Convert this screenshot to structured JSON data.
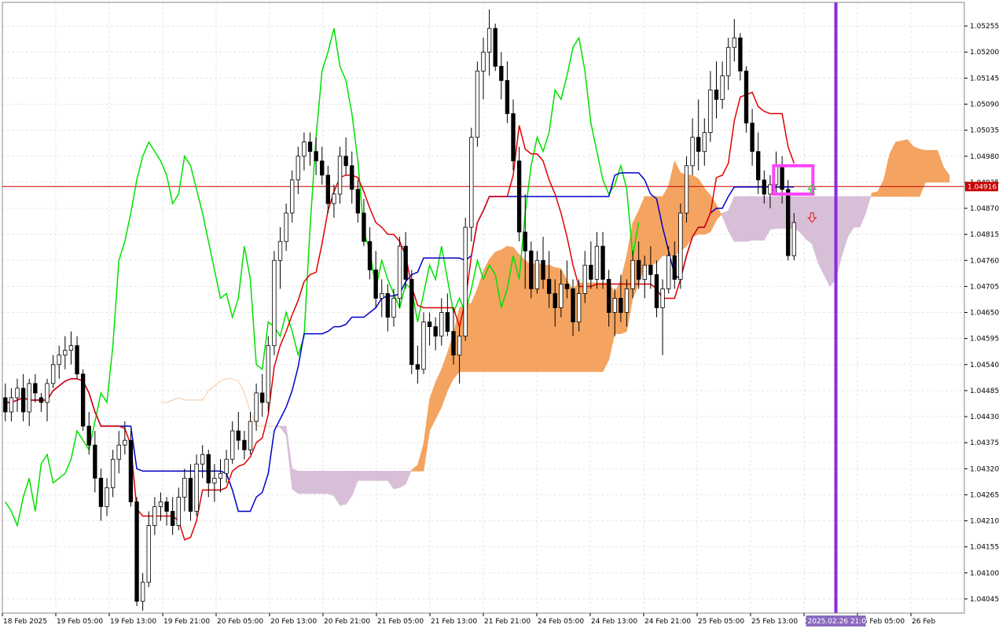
{
  "chart_data": {
    "type": "candlestick",
    "instrument_timeframe": "",
    "y_ticks": [
      "1.05255",
      "1.05200",
      "1.05145",
      "1.05090",
      "1.05035",
      "1.04980",
      "1.04925",
      "1.04870",
      "1.04815",
      "1.04760",
      "1.04705",
      "1.04650",
      "1.04595",
      "1.04540",
      "1.04485",
      "1.04430",
      "1.04375",
      "1.04320",
      "1.04265",
      "1.04210",
      "1.04155",
      "1.04100",
      "1.04045"
    ],
    "ylim": [
      1.04015,
      1.05305
    ],
    "x_labels": [
      "18 Feb 2025",
      "19 Feb 05:00",
      "19 Feb 13:00",
      "19 Feb 21:00",
      "20 Feb 05:00",
      "20 Feb 13:00",
      "20 Feb 21:00",
      "21 Feb 05:00",
      "21 Feb 13:00",
      "21 Feb 21:00",
      "24 Feb 05:00",
      "24 Feb 13:00",
      "24 Feb 21:00",
      "25 Feb 05:00",
      "25 Feb 13:00",
      "25 Feb 21:00",
      "26 Feb 05:00",
      "26 Feb"
    ],
    "current_price": "1.04916",
    "vline_label": "2025.02.26 21:00",
    "grid": true,
    "colors": {
      "bull_body": "#ffffff",
      "bear_body": "#000000",
      "tenkan": "#e00000",
      "kijun": "#0000c8",
      "chikou": "#00e000",
      "kumo_bull": "#f4a460",
      "kumo_bear": "#d8bfd8",
      "price_line": "#c80000",
      "vline": "#8a2be2",
      "highlight": "#ff44ff"
    },
    "candles": [
      [
        1.0447,
        1.045,
        1.0442,
        1.0444
      ],
      [
        1.0444,
        1.0449,
        1.0442,
        1.0447
      ],
      [
        1.0447,
        1.0451,
        1.0444,
        1.0449
      ],
      [
        1.0449,
        1.0452,
        1.0442,
        1.0444
      ],
      [
        1.0444,
        1.0451,
        1.0441,
        1.045
      ],
      [
        1.045,
        1.0452,
        1.0446,
        1.0448
      ],
      [
        1.0447,
        1.0448,
        1.0444,
        1.0446
      ],
      [
        1.0446,
        1.0451,
        1.0442,
        1.045
      ],
      [
        1.045,
        1.0456,
        1.0449,
        1.0454
      ],
      [
        1.0454,
        1.0458,
        1.0451,
        1.0456
      ],
      [
        1.0456,
        1.046,
        1.0453,
        1.0457
      ],
      [
        1.0457,
        1.0461,
        1.0454,
        1.0458
      ],
      [
        1.0458,
        1.046,
        1.0451,
        1.0452
      ],
      [
        1.0452,
        1.0453,
        1.044,
        1.0441
      ],
      [
        1.0441,
        1.0444,
        1.0435,
        1.0437
      ],
      [
        1.0437,
        1.044,
        1.0427,
        1.043
      ],
      [
        1.043,
        1.0432,
        1.0421,
        1.0424
      ],
      [
        1.0424,
        1.043,
        1.0422,
        1.0428
      ],
      [
        1.0428,
        1.0436,
        1.0426,
        1.0434
      ],
      [
        1.0434,
        1.044,
        1.0431,
        1.0437
      ],
      [
        1.0437,
        1.0442,
        1.0435,
        1.0438
      ],
      [
        1.0438,
        1.044,
        1.0424,
        1.0425
      ],
      [
        1.0425,
        1.0426,
        1.0403,
        1.0404
      ],
      [
        1.0404,
        1.041,
        1.0402,
        1.0408
      ],
      [
        1.0408,
        1.0423,
        1.0407,
        1.042
      ],
      [
        1.042,
        1.0426,
        1.0418,
        1.0424
      ],
      [
        1.0424,
        1.0427,
        1.0421,
        1.0425
      ],
      [
        1.0425,
        1.0426,
        1.042,
        1.0423
      ],
      [
        1.0423,
        1.0426,
        1.0418,
        1.042
      ],
      [
        1.042,
        1.0428,
        1.0419,
        1.0426
      ],
      [
        1.0426,
        1.0432,
        1.0423,
        1.043
      ],
      [
        1.043,
        1.0433,
        1.0421,
        1.0423
      ],
      [
        1.0423,
        1.0435,
        1.0422,
        1.0433
      ],
      [
        1.0433,
        1.0437,
        1.043,
        1.0435
      ],
      [
        1.0435,
        1.0436,
        1.0426,
        1.0429
      ],
      [
        1.0429,
        1.0433,
        1.0425,
        1.043
      ],
      [
        1.043,
        1.0434,
        1.0427,
        1.0431
      ],
      [
        1.0431,
        1.0436,
        1.0429,
        1.0434
      ],
      [
        1.0434,
        1.0442,
        1.0433,
        1.044
      ],
      [
        1.044,
        1.0444,
        1.0436,
        1.0438
      ],
      [
        1.0438,
        1.044,
        1.0434,
        1.0436
      ],
      [
        1.0436,
        1.0444,
        1.0435,
        1.0442
      ],
      [
        1.0442,
        1.045,
        1.044,
        1.0448
      ],
      [
        1.0448,
        1.0452,
        1.0443,
        1.0446
      ],
      [
        1.0446,
        1.046,
        1.0444,
        1.0458
      ],
      [
        1.0458,
        1.0478,
        1.0456,
        1.0476
      ],
      [
        1.0476,
        1.0483,
        1.047,
        1.048
      ],
      [
        1.048,
        1.0488,
        1.0478,
        1.0486
      ],
      [
        1.0486,
        1.0495,
        1.0484,
        1.0493
      ],
      [
        1.0493,
        1.05,
        1.049,
        1.0498
      ],
      [
        1.0498,
        1.0503,
        1.0495,
        1.0501
      ],
      [
        1.0501,
        1.0503,
        1.0496,
        1.0499
      ],
      [
        1.0499,
        1.0502,
        1.0494,
        1.0497
      ],
      [
        1.0497,
        1.05,
        1.0492,
        1.0494
      ],
      [
        1.0494,
        1.0496,
        1.0486,
        1.0488
      ],
      [
        1.0488,
        1.0492,
        1.0485,
        1.049
      ],
      [
        1.049,
        1.05,
        1.0488,
        1.0498
      ],
      [
        1.0498,
        1.0502,
        1.0494,
        1.0496
      ],
      [
        1.0496,
        1.0499,
        1.0488,
        1.0491
      ],
      [
        1.0491,
        1.0493,
        1.0484,
        1.0486
      ],
      [
        1.0486,
        1.0489,
        1.0479,
        1.048
      ],
      [
        1.048,
        1.0483,
        1.0472,
        1.0474
      ],
      [
        1.0474,
        1.0478,
        1.0466,
        1.0468
      ],
      [
        1.0468,
        1.0472,
        1.0464,
        1.0469
      ],
      [
        1.0469,
        1.0471,
        1.0461,
        1.0464
      ],
      [
        1.0464,
        1.047,
        1.0462,
        1.0468
      ],
      [
        1.0468,
        1.0481,
        1.0466,
        1.0479
      ],
      [
        1.0479,
        1.0482,
        1.047,
        1.0472
      ],
      [
        1.0472,
        1.0474,
        1.0452,
        1.0454
      ],
      [
        1.0454,
        1.0458,
        1.045,
        1.0453
      ],
      [
        1.0453,
        1.0465,
        1.0452,
        1.0463
      ],
      [
        1.0463,
        1.0465,
        1.0458,
        1.0462
      ],
      [
        1.0462,
        1.0464,
        1.0457,
        1.046
      ],
      [
        1.046,
        1.0468,
        1.0458,
        1.0465
      ],
      [
        1.0465,
        1.0469,
        1.046,
        1.0461
      ],
      [
        1.0461,
        1.0466,
        1.0454,
        1.0456
      ],
      [
        1.0456,
        1.0462,
        1.045,
        1.046
      ],
      [
        1.046,
        1.0485,
        1.0459,
        1.0483
      ],
      [
        1.0483,
        1.0504,
        1.048,
        1.0502
      ],
      [
        1.0502,
        1.0518,
        1.05,
        1.0516
      ],
      [
        1.0516,
        1.0523,
        1.051,
        1.052
      ],
      [
        1.052,
        1.0529,
        1.0515,
        1.0525
      ],
      [
        1.0525,
        1.0526,
        1.0516,
        1.0517
      ],
      [
        1.0517,
        1.052,
        1.051,
        1.0514
      ],
      [
        1.0514,
        1.0518,
        1.0505,
        1.0507
      ],
      [
        1.0507,
        1.051,
        1.0495,
        1.0497
      ],
      [
        1.0497,
        1.05,
        1.048,
        1.0482
      ],
      [
        1.0482,
        1.049,
        1.047,
        1.0478
      ],
      [
        1.0478,
        1.048,
        1.0468,
        1.047
      ],
      [
        1.047,
        1.0478,
        1.0469,
        1.0476
      ],
      [
        1.0476,
        1.0481,
        1.047,
        1.0472
      ],
      [
        1.0472,
        1.0478,
        1.0466,
        1.0469
      ],
      [
        1.0469,
        1.0472,
        1.0462,
        1.0466
      ],
      [
        1.0466,
        1.0474,
        1.0464,
        1.0471
      ],
      [
        1.0471,
        1.0476,
        1.0468,
        1.047
      ],
      [
        1.047,
        1.0472,
        1.046,
        1.0463
      ],
      [
        1.0463,
        1.0472,
        1.0461,
        1.0469
      ],
      [
        1.0469,
        1.0478,
        1.0467,
        1.0475
      ],
      [
        1.0475,
        1.048,
        1.047,
        1.0472
      ],
      [
        1.0472,
        1.0482,
        1.047,
        1.0479
      ],
      [
        1.0479,
        1.0482,
        1.047,
        1.0472
      ],
      [
        1.0472,
        1.0474,
        1.0462,
        1.0465
      ],
      [
        1.0465,
        1.047,
        1.046,
        1.0468
      ],
      [
        1.0468,
        1.0473,
        1.0463,
        1.0465
      ],
      [
        1.0465,
        1.0472,
        1.0462,
        1.047
      ],
      [
        1.047,
        1.0478,
        1.0468,
        1.0476
      ],
      [
        1.0476,
        1.048,
        1.047,
        1.0472
      ],
      [
        1.0472,
        1.0477,
        1.0468,
        1.0475
      ],
      [
        1.0475,
        1.0479,
        1.047,
        1.0473
      ],
      [
        1.0473,
        1.0476,
        1.0464,
        1.0466
      ],
      [
        1.0466,
        1.0472,
        1.0456,
        1.047
      ],
      [
        1.047,
        1.0479,
        1.0469,
        1.0477
      ],
      [
        1.0477,
        1.048,
        1.047,
        1.0472
      ],
      [
        1.0472,
        1.0488,
        1.047,
        1.0486
      ],
      [
        1.0486,
        1.0498,
        1.0484,
        1.0496
      ],
      [
        1.0496,
        1.0506,
        1.0494,
        1.0502
      ],
      [
        1.0502,
        1.051,
        1.0495,
        1.0499
      ],
      [
        1.0499,
        1.0506,
        1.0496,
        1.0503
      ],
      [
        1.0503,
        1.0516,
        1.0501,
        1.0512
      ],
      [
        1.0512,
        1.0518,
        1.0506,
        1.051
      ],
      [
        1.051,
        1.0518,
        1.0508,
        1.0515
      ],
      [
        1.0515,
        1.0523,
        1.0512,
        1.0521
      ],
      [
        1.0521,
        1.0527,
        1.0518,
        1.0523
      ],
      [
        1.0523,
        1.0524,
        1.0514,
        1.0516
      ],
      [
        1.0516,
        1.0517,
        1.0503,
        1.0505
      ],
      [
        1.0505,
        1.0508,
        1.0496,
        1.0499
      ],
      [
        1.0499,
        1.0503,
        1.049,
        1.0493
      ],
      [
        1.0493,
        1.0495,
        1.0488,
        1.049
      ],
      [
        1.049,
        1.0494,
        1.0487,
        1.0492
      ],
      [
        1.0492,
        1.0499,
        1.049,
        1.0496
      ],
      [
        1.0496,
        1.0498,
        1.0488,
        1.0491
      ],
      [
        1.0491,
        1.0493,
        1.0476,
        1.0477
      ],
      [
        1.0477,
        1.0486,
        1.0476,
        1.0484
      ]
    ]
  }
}
